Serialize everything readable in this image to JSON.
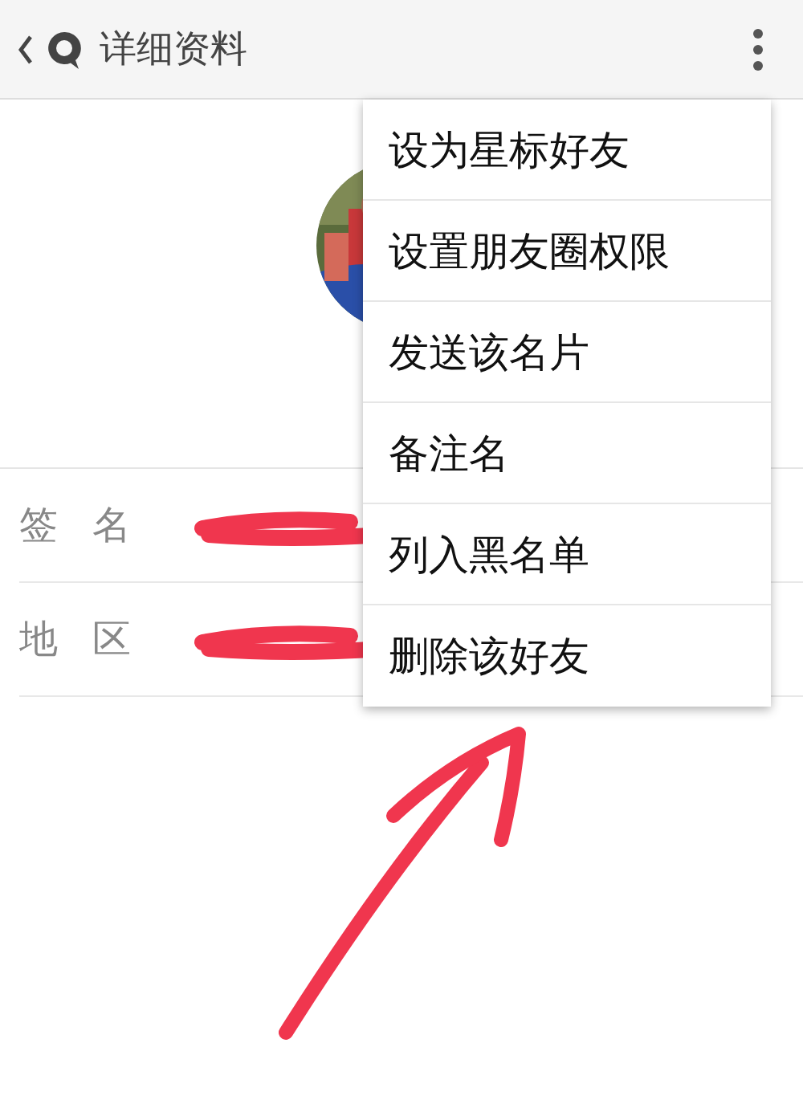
{
  "header": {
    "title": "详细资料"
  },
  "profile": {
    "rows": [
      {
        "label": "签 名",
        "redacted": true
      },
      {
        "label": "地 区",
        "redacted": true
      }
    ]
  },
  "menu": {
    "items": [
      {
        "label": "设为星标好友"
      },
      {
        "label": "设置朋友圈权限"
      },
      {
        "label": "发送该名片"
      },
      {
        "label": "备注名"
      },
      {
        "label": "列入黑名单"
      },
      {
        "label": "删除该好友"
      }
    ]
  },
  "annotations": [
    {
      "kind": "arrow"
    }
  ]
}
